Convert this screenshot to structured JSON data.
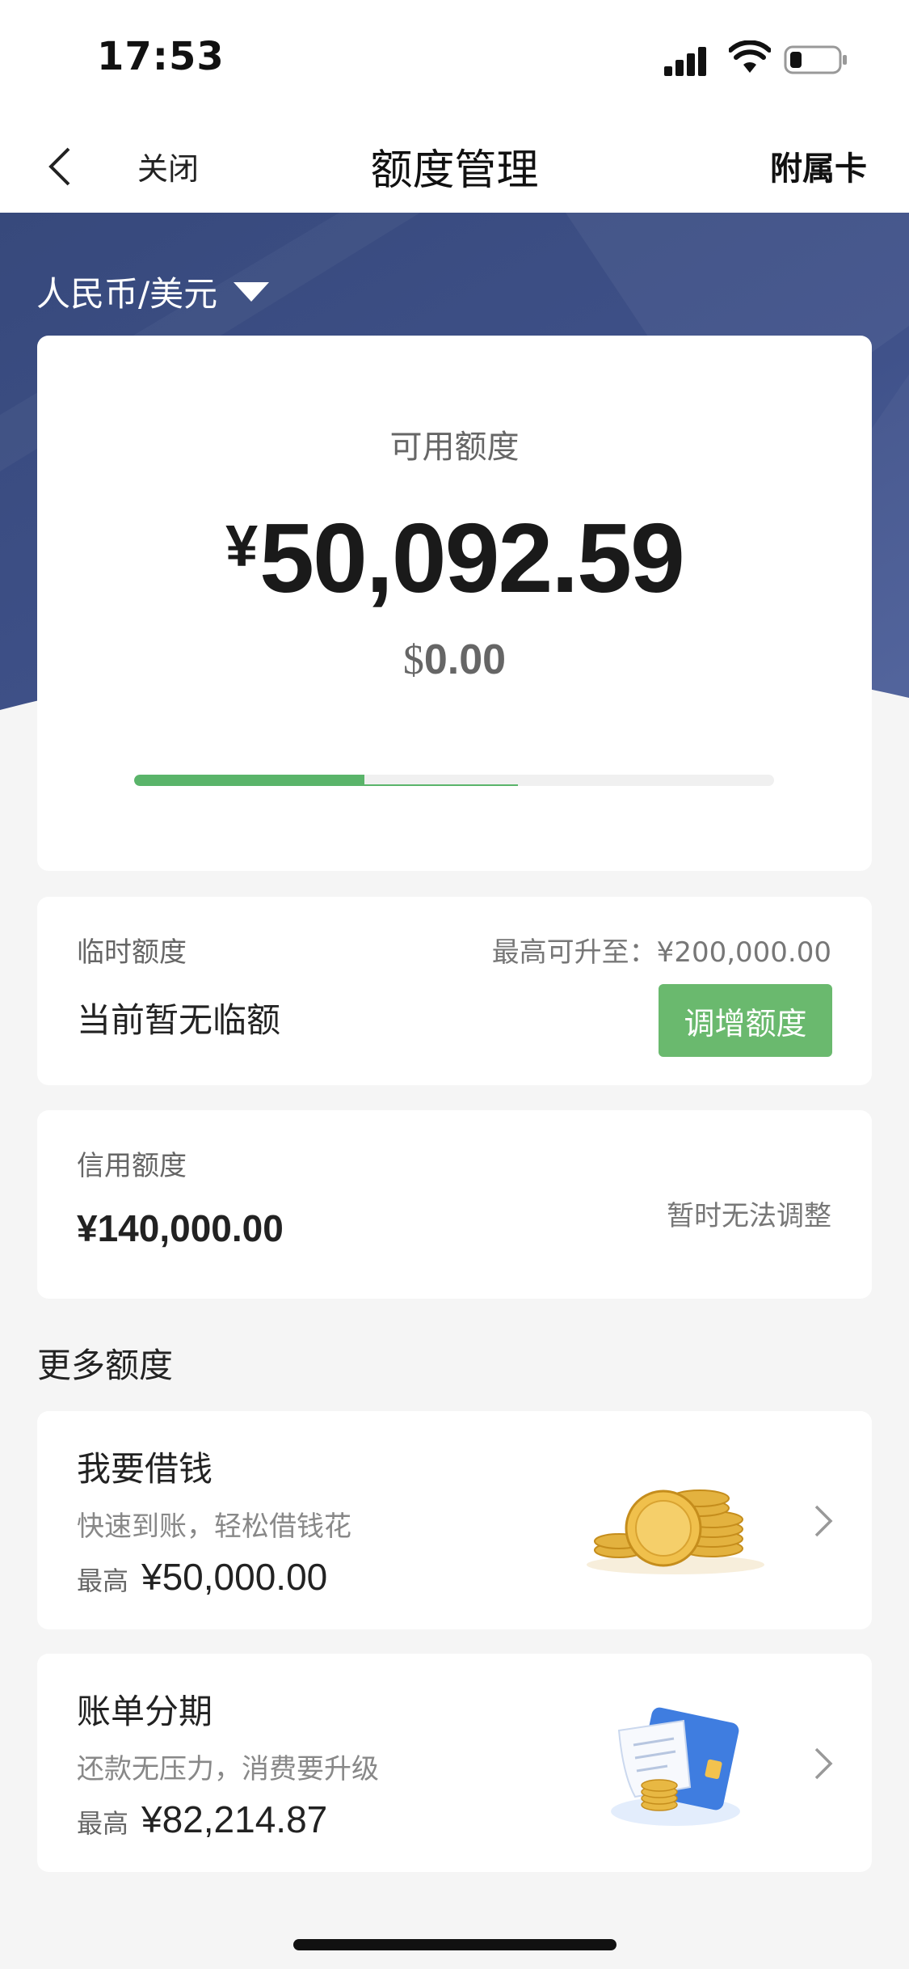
{
  "status_bar": {
    "time": "17:53"
  },
  "nav": {
    "close_label": "关闭",
    "title": "额度管理",
    "right_label": "附属卡"
  },
  "currency_selector": {
    "label": "人民币/美元"
  },
  "available": {
    "label": "可用额度",
    "cny_symbol": "¥",
    "cny_amount": "50,092.59",
    "usd_symbol": "$",
    "usd_amount": "0.00",
    "usage_fraction": 0.36
  },
  "temp_credit": {
    "label": "临时额度",
    "max_text": "最高可升至：¥200,000.00",
    "status": "当前暂无临额",
    "button_label": "调增额度"
  },
  "credit_limit": {
    "label": "信用额度",
    "amount": "¥140,000.00",
    "note": "暂时无法调整"
  },
  "more_section": {
    "title": "更多额度"
  },
  "loan": {
    "title": "我要借钱",
    "subtitle": "快速到账，轻松借钱花",
    "max_label": "最高",
    "max_value": "¥50,000.00",
    "icon": "gold-coins-icon"
  },
  "installment": {
    "title": "账单分期",
    "subtitle": "还款无压力，消费要升级",
    "max_label": "最高",
    "max_value": "¥82,214.87",
    "icon": "bill-card-icon"
  },
  "colors": {
    "header_blue": "#3d4f86",
    "accent_green": "#6ab96e"
  }
}
